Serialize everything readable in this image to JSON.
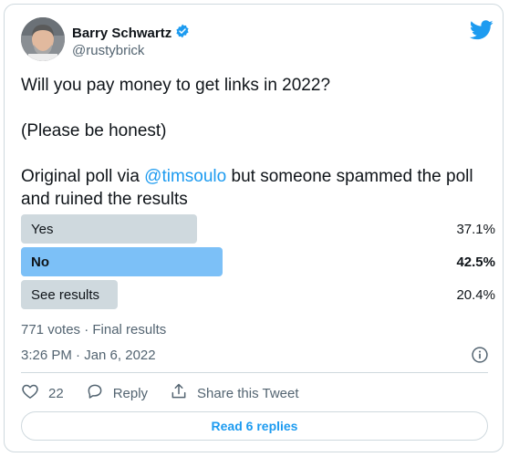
{
  "author": {
    "name": "Barry Schwartz",
    "handle": "@rustybrick",
    "verified": true
  },
  "tweet": {
    "line1": "Will you pay money to get links in 2022?",
    "line2": "(Please be honest)",
    "line3_prefix": "Original poll via ",
    "mention": "@timsoulo",
    "line3_suffix": " but someone spammed the poll and ruined the results"
  },
  "poll": {
    "options": [
      {
        "label": "Yes",
        "percent": "37.1%",
        "winner": false,
        "fraction": 0.371
      },
      {
        "label": "No",
        "percent": "42.5%",
        "winner": true,
        "fraction": 0.425
      },
      {
        "label": "See results",
        "percent": "20.4%",
        "winner": false,
        "fraction": 0.204
      }
    ],
    "summary": "771 votes · Final results"
  },
  "timestamp": "3:26 PM · Jan 6, 2022",
  "actions": {
    "like_count": "22",
    "reply_label": "Reply",
    "share_label": "Share this Tweet"
  },
  "read_replies_label": "Read 6 replies",
  "colors": {
    "twitter_blue": "#1d9bf0",
    "poll_winner": "#7cc0f7",
    "poll_default": "#cfd9de"
  },
  "icons": [
    "verified-badge-icon",
    "twitter-bird-icon",
    "info-icon",
    "heart-icon",
    "reply-icon",
    "share-icon"
  ]
}
